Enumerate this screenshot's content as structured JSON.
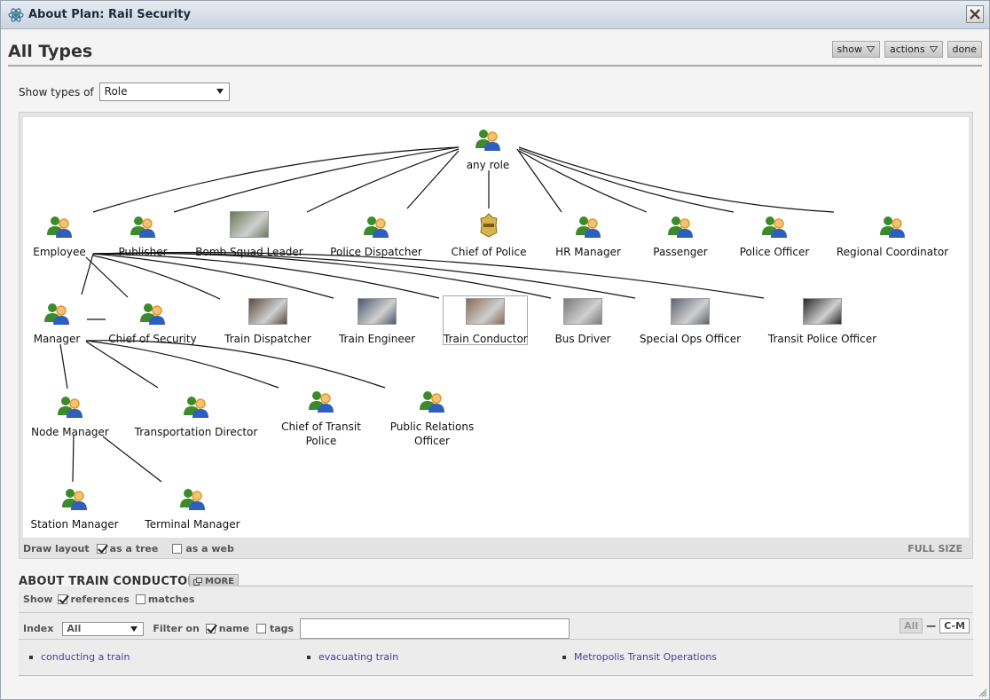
{
  "window": {
    "title": "About Plan: Rail Security"
  },
  "header": {
    "page_title": "All Types",
    "buttons": {
      "show": "show",
      "actions": "actions",
      "done": "done"
    }
  },
  "type_selector": {
    "label": "Show types of",
    "value": "Role"
  },
  "graph": {
    "nodes": {
      "any_role": "any role",
      "employee": "Employee",
      "publisher": "Publisher",
      "bomb_squad_leader": "Bomb Squad Leader",
      "police_dispatcher": "Police Dispatcher",
      "chief_of_police": "Chief of Police",
      "hr_manager": "HR Manager",
      "passenger": "Passenger",
      "police_officer": "Police Officer",
      "regional_coordinator": "Regional Coordinator",
      "manager": "Manager",
      "chief_of_security": "Chief of Security",
      "train_dispatcher": "Train Dispatcher",
      "train_engineer": "Train Engineer",
      "train_conductor": "Train Conductor",
      "bus_driver": "Bus Driver",
      "special_ops_officer": "Special Ops Officer",
      "transit_police_officer": "Transit Police Officer",
      "node_manager": "Node Manager",
      "transportation_director": "Transportation Director",
      "chief_of_transit_police": "Chief of Transit Police",
      "public_relations_officer": "Public Relations Officer",
      "station_manager": "Station Manager",
      "terminal_manager": "Terminal Manager"
    },
    "selected": "train_conductor",
    "icons": {
      "role": "role-people-icon",
      "badge": "police-badge-icon",
      "photo": "photo-thumbnail"
    }
  },
  "layout_bar": {
    "label": "Draw layout",
    "tree": {
      "label": "as a tree",
      "checked": true
    },
    "web": {
      "label": "as a web",
      "checked": false
    },
    "full_size": "FULL SIZE"
  },
  "about": {
    "title": "ABOUT TRAIN CONDUCTOR",
    "more": "MORE",
    "show_label": "Show",
    "references": {
      "label": "references",
      "checked": true
    },
    "matches": {
      "label": "matches",
      "checked": false
    },
    "index_label": "Index",
    "index_value": "All",
    "filter_label": "Filter on",
    "name": {
      "label": "name",
      "checked": true
    },
    "tags": {
      "label": "tags",
      "checked": false
    },
    "filter_value": "",
    "alpha_all": "All",
    "alpha_sep": "—",
    "alpha_cm": "C-M",
    "refs": [
      "conducting a train",
      "evacuating train",
      "Metropolis Transit Operations"
    ]
  }
}
